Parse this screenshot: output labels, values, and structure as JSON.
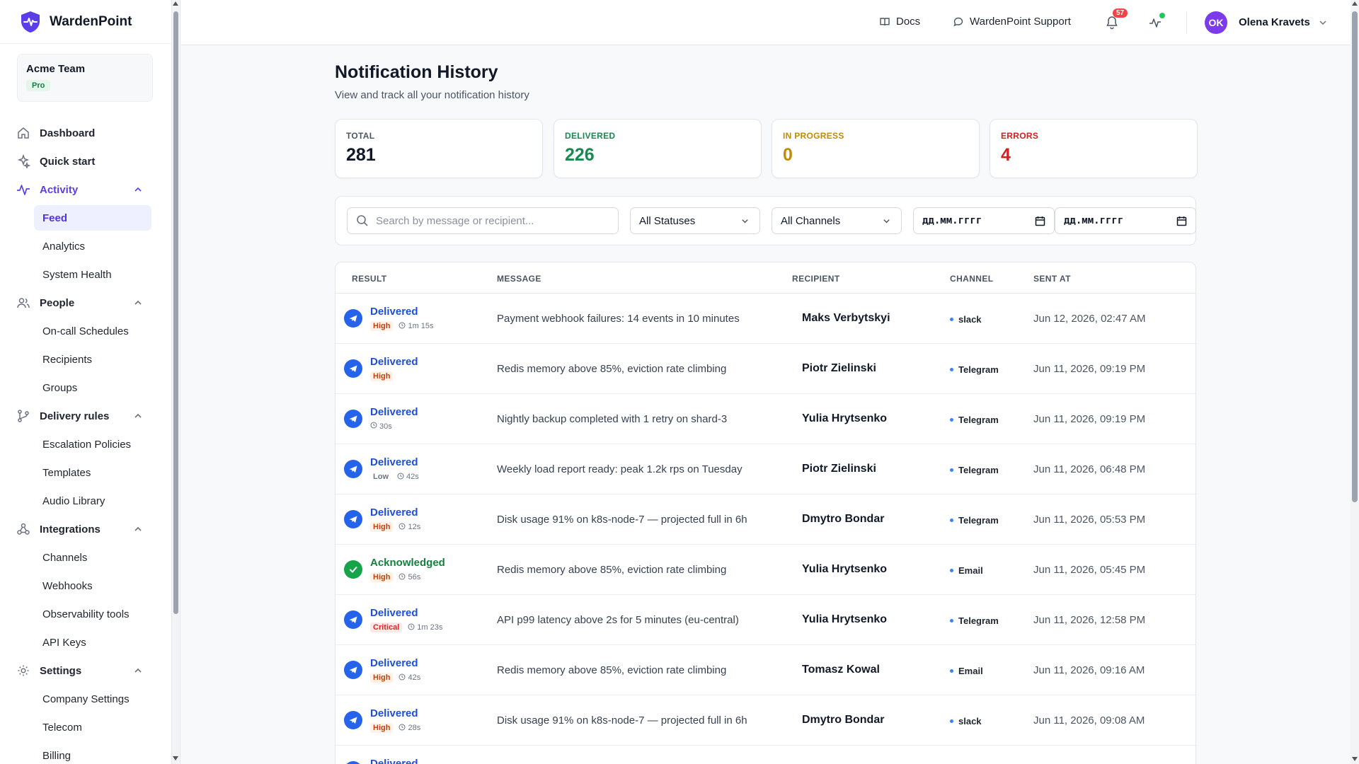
{
  "brand": {
    "name": "WardenPoint",
    "accent": "#5b3ee8"
  },
  "team": {
    "name": "Acme Team",
    "plan": "Pro"
  },
  "sidebar": {
    "items": [
      {
        "label": "Dashboard",
        "icon": "home-icon"
      },
      {
        "label": "Quick start",
        "icon": "sparkle-icon"
      },
      {
        "label": "Activity",
        "icon": "activity-icon",
        "expanded": true,
        "active": true,
        "children": [
          "Feed",
          "Analytics",
          "System Health"
        ],
        "active_child": "Feed"
      },
      {
        "label": "People",
        "icon": "users-icon",
        "expanded": true,
        "children": [
          "On-call Schedules",
          "Recipients",
          "Groups"
        ]
      },
      {
        "label": "Delivery rules",
        "icon": "branch-icon",
        "expanded": true,
        "children": [
          "Escalation Policies",
          "Templates",
          "Audio Library"
        ]
      },
      {
        "label": "Integrations",
        "icon": "webhook-icon",
        "expanded": true,
        "children": [
          "Channels",
          "Webhooks",
          "Observability tools",
          "API Keys"
        ]
      },
      {
        "label": "Settings",
        "icon": "gear-icon",
        "expanded": true,
        "children": [
          "Company Settings",
          "Telecom",
          "Billing"
        ]
      }
    ]
  },
  "header": {
    "docs": "Docs",
    "support": "WardenPoint Support",
    "notifications_count": "57",
    "user": {
      "initials": "OK",
      "name": "Olena Kravets"
    }
  },
  "page": {
    "title": "Notification History",
    "subtitle": "View and track all your notification history"
  },
  "stats": [
    {
      "label": "TOTAL",
      "value": "281",
      "color": "#111827"
    },
    {
      "label": "DELIVERED",
      "value": "226",
      "color": "#168a4f"
    },
    {
      "label": "IN PROGRESS",
      "value": "0",
      "color": "#c28a05"
    },
    {
      "label": "ERRORS",
      "value": "4",
      "color": "#d32020"
    }
  ],
  "filters": {
    "search_placeholder": "Search by message or recipient...",
    "status": "All Statuses",
    "channel": "All Channels",
    "date_from": "дд.мм.гггг",
    "date_to": "дд.мм.гггг"
  },
  "table": {
    "headers": [
      "RESULT",
      "MESSAGE",
      "RECIPIENT",
      "CHANNEL",
      "SENT AT"
    ],
    "rows": [
      {
        "status": "Delivered",
        "priority": "High",
        "duration": "1m 15s",
        "message": "Payment webhook failures: 14 events in 10 minutes",
        "recipient": "Maks Verbytskyi",
        "channel": "slack",
        "sent": "Jun 12, 2026, 02:47 AM"
      },
      {
        "status": "Delivered",
        "priority": "High",
        "duration": "",
        "message": "Redis memory above 85%, eviction rate climbing",
        "recipient": "Piotr Zielinski",
        "channel": "Telegram",
        "sent": "Jun 11, 2026, 09:19 PM"
      },
      {
        "status": "Delivered",
        "priority": "",
        "duration": "30s",
        "message": "Nightly backup completed with 1 retry on shard-3",
        "recipient": "Yulia Hrytsenko",
        "channel": "Telegram",
        "sent": "Jun 11, 2026, 09:19 PM"
      },
      {
        "status": "Delivered",
        "priority": "Low",
        "duration": "42s",
        "message": "Weekly load report ready: peak 1.2k rps on Tuesday",
        "recipient": "Piotr Zielinski",
        "channel": "Telegram",
        "sent": "Jun 11, 2026, 06:48 PM"
      },
      {
        "status": "Delivered",
        "priority": "High",
        "duration": "12s",
        "message": "Disk usage 91% on k8s-node-7 — projected full in 6h",
        "recipient": "Dmytro Bondar",
        "channel": "Telegram",
        "sent": "Jun 11, 2026, 05:53 PM"
      },
      {
        "status": "Acknowledged",
        "priority": "High",
        "duration": "56s",
        "message": "Redis memory above 85%, eviction rate climbing",
        "recipient": "Yulia Hrytsenko",
        "channel": "Email",
        "sent": "Jun 11, 2026, 05:45 PM"
      },
      {
        "status": "Delivered",
        "priority": "Critical",
        "duration": "1m 23s",
        "message": "API p99 latency above 2s for 5 minutes (eu-central)",
        "recipient": "Yulia Hrytsenko",
        "channel": "Telegram",
        "sent": "Jun 11, 2026, 12:58 PM"
      },
      {
        "status": "Delivered",
        "priority": "High",
        "duration": "42s",
        "message": "Redis memory above 85%, eviction rate climbing",
        "recipient": "Tomasz Kowal",
        "channel": "Email",
        "sent": "Jun 11, 2026, 09:16 AM"
      },
      {
        "status": "Delivered",
        "priority": "High",
        "duration": "28s",
        "message": "Disk usage 91% on k8s-node-7 — projected full in 6h",
        "recipient": "Dmytro Bondar",
        "channel": "slack",
        "sent": "Jun 11, 2026, 09:08 AM"
      },
      {
        "status": "Delivered",
        "priority": "",
        "duration": "",
        "message": "",
        "recipient": "",
        "channel": "",
        "sent": ""
      }
    ]
  },
  "colors": {
    "delivered": "#1d4ed8",
    "acknowledged": "#15803d"
  }
}
